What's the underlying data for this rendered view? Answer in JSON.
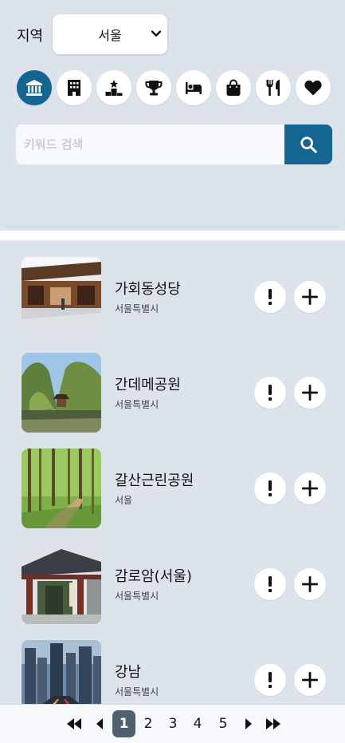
{
  "region": {
    "label": "지역",
    "selected": "서울"
  },
  "categories": [
    {
      "icon": "museum-icon",
      "active": true
    },
    {
      "icon": "hotel-building-icon",
      "active": false
    },
    {
      "icon": "podium-icon",
      "active": false
    },
    {
      "icon": "trophy-icon",
      "active": false
    },
    {
      "icon": "bed-icon",
      "active": false
    },
    {
      "icon": "shopping-bag-icon",
      "active": false
    },
    {
      "icon": "utensils-icon",
      "active": false
    },
    {
      "icon": "heart-icon",
      "active": false
    }
  ],
  "search": {
    "placeholder": "키워드 검색",
    "value": ""
  },
  "items": [
    {
      "title": "가회동성당",
      "subtitle": "서울특별시",
      "image": "hanok-courtyard"
    },
    {
      "title": "간데메공원",
      "subtitle": "서울특별시",
      "image": "park-pavilion-cliff"
    },
    {
      "title": "갈산근린공원",
      "subtitle": "서울",
      "image": "forest-path"
    },
    {
      "title": "감로암(서울)",
      "subtitle": "서울특별시",
      "image": "temple-gate"
    },
    {
      "title": "강남",
      "subtitle": "서울특별시",
      "image": "city-night"
    }
  ],
  "item_actions": {
    "info": "!",
    "add": "+"
  },
  "pagination": {
    "pages": [
      "1",
      "2",
      "3",
      "4",
      "5"
    ],
    "current": "1"
  },
  "colors": {
    "accent": "#156592",
    "background": "#dde3eb",
    "current_page": "#4f6070"
  }
}
